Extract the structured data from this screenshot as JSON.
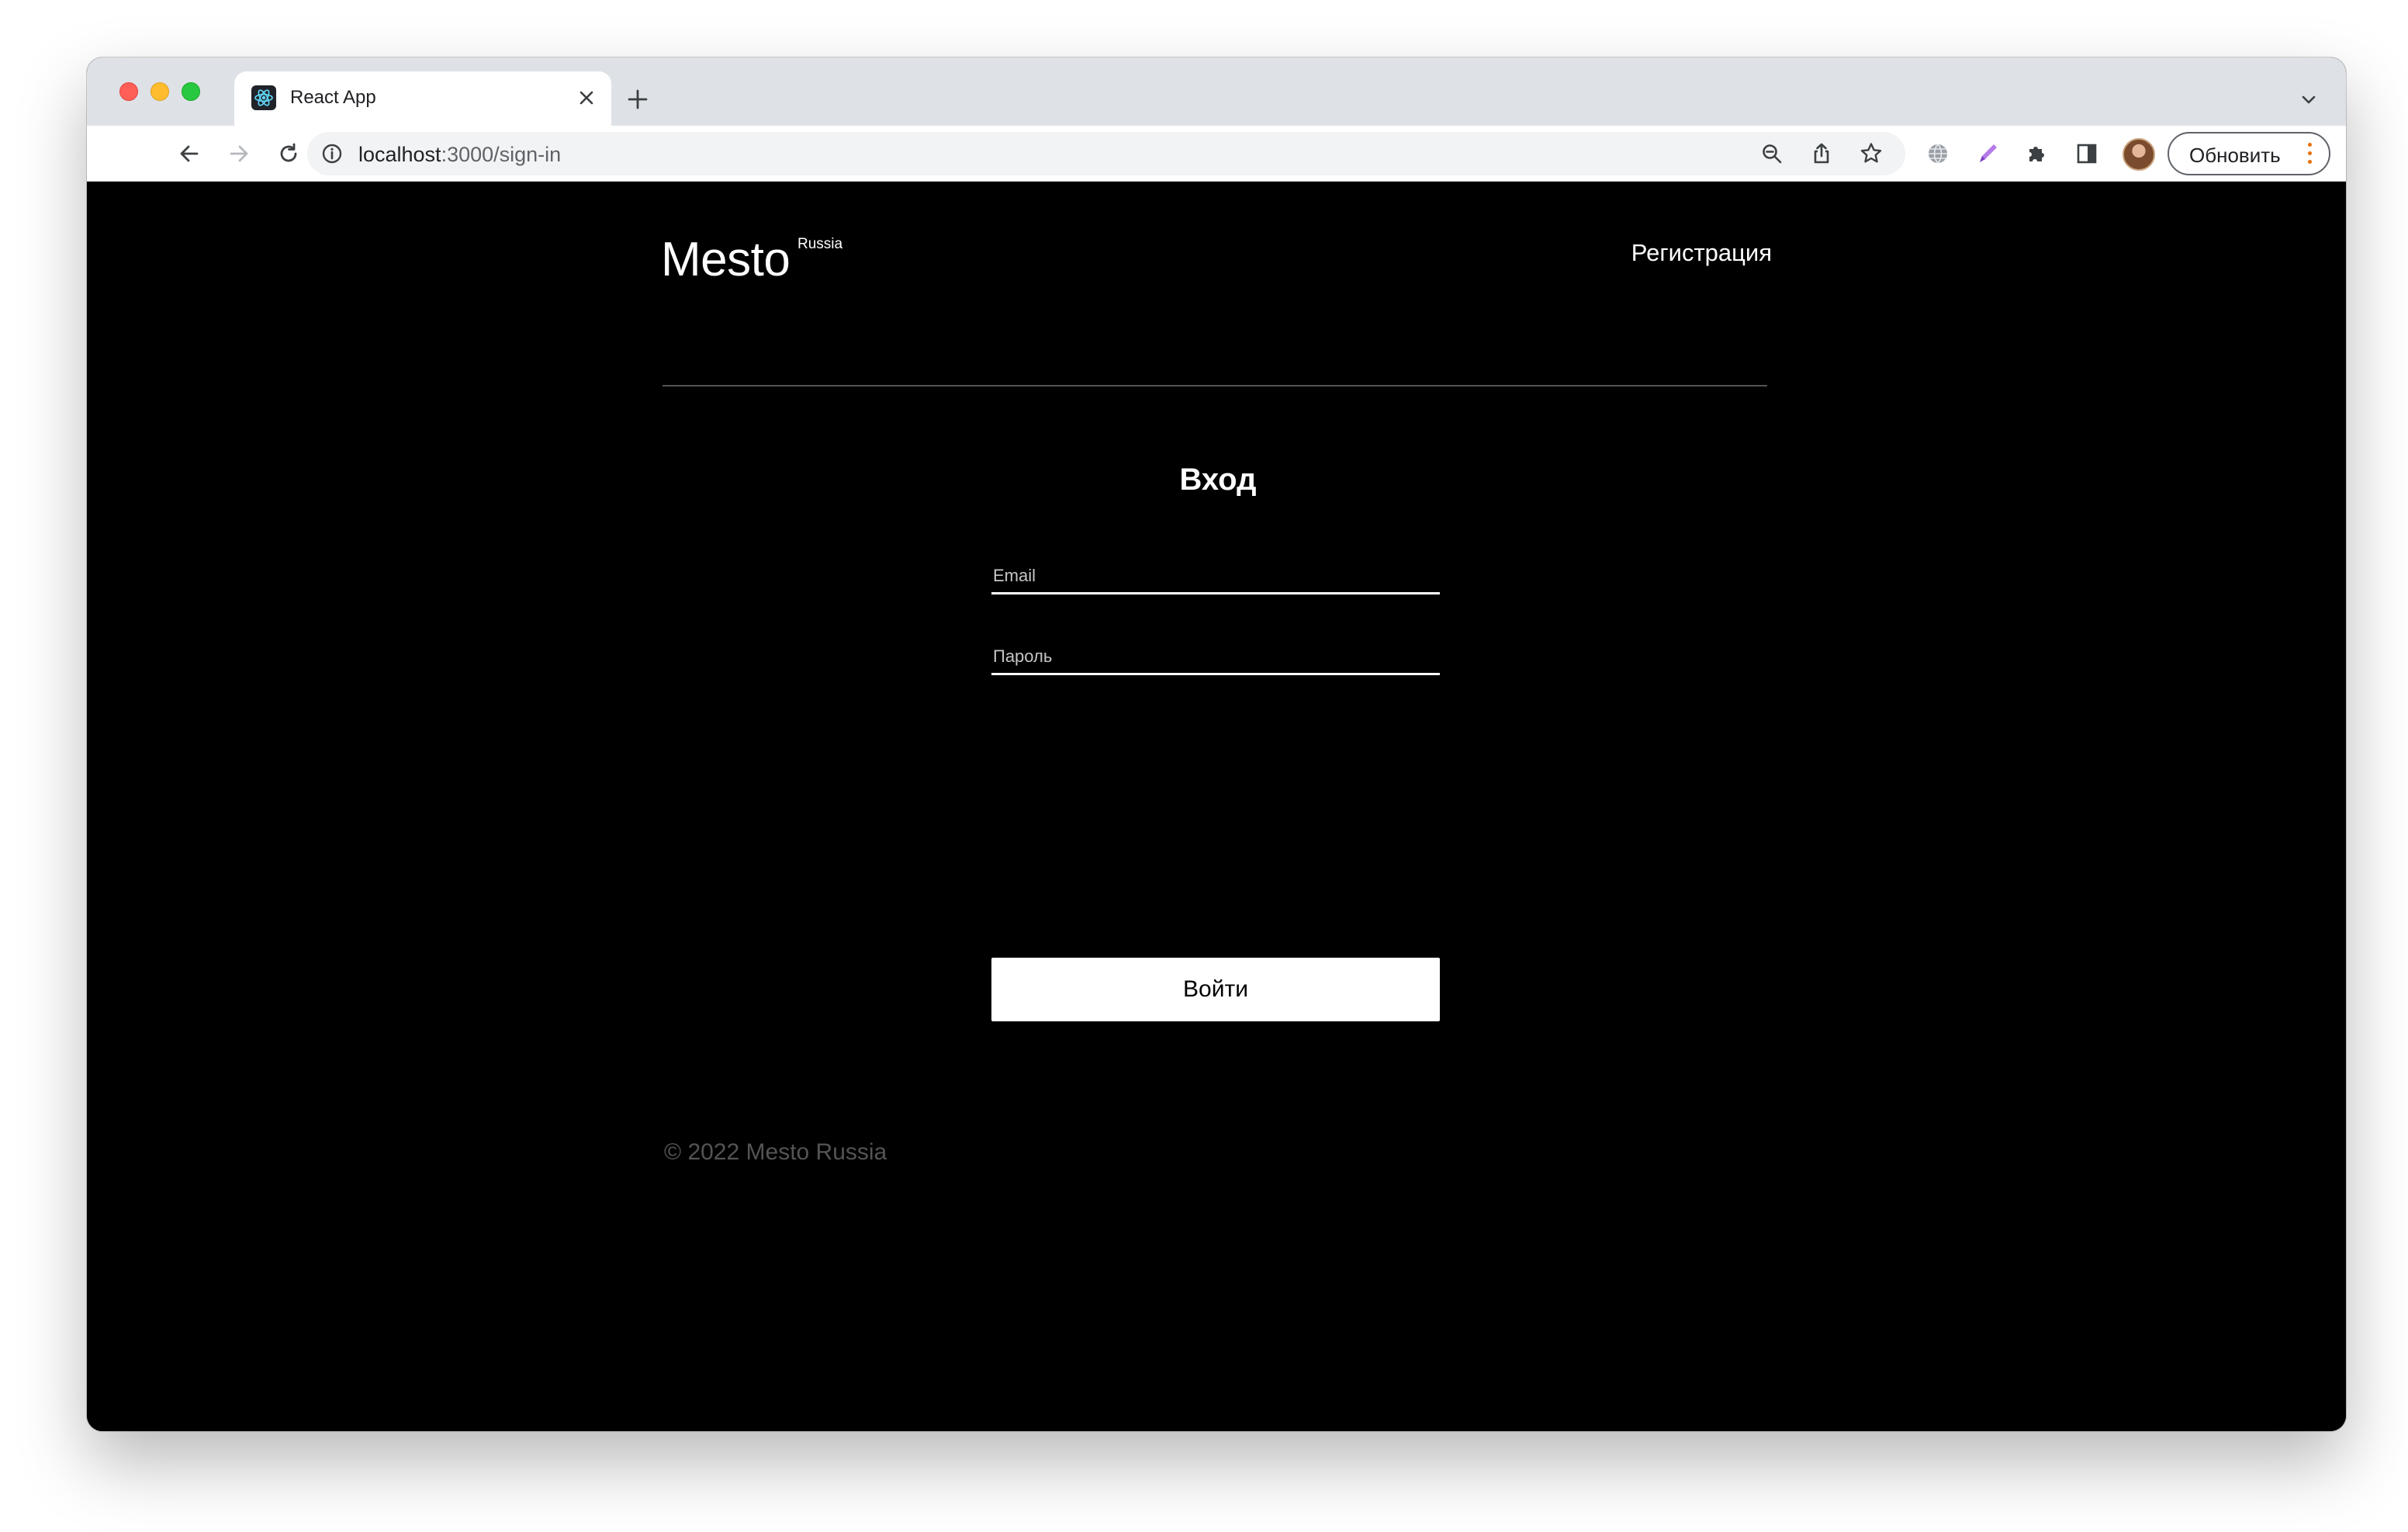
{
  "browser": {
    "tab": {
      "title": "React App",
      "favicon": "react-icon"
    },
    "address": {
      "host": "localhost",
      "path": ":3000/sign-in"
    },
    "update_button_label": "Обновить",
    "icons": [
      "back-arrow-icon",
      "forward-arrow-icon",
      "reload-icon",
      "home-icon",
      "info-icon",
      "zoom-icon",
      "share-icon",
      "bookmark-star-icon",
      "translate-globe-icon",
      "pen-icon",
      "extensions-puzzle-icon",
      "side-panel-icon",
      "avatar",
      "more-icon"
    ]
  },
  "page": {
    "logo": "Mesto",
    "logo_superscript": "Russia",
    "nav_link": "Регистрация",
    "form": {
      "title": "Вход",
      "email_placeholder": "Email",
      "password_placeholder": "Пароль",
      "submit_label": "Войти"
    },
    "footer": "© 2022 Mesto Russia"
  },
  "colors": {
    "page_background": "#000000",
    "text": "#ffffff",
    "footer_text": "#545454",
    "divider": "#545454",
    "button_background": "#ffffff",
    "button_text": "#000000"
  }
}
